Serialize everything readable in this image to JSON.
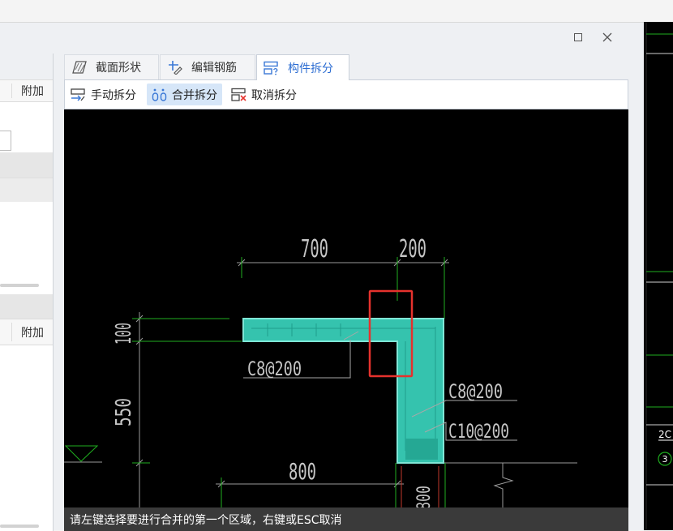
{
  "left_panel": {
    "header_top": "附加",
    "header_bottom": "附加"
  },
  "tabs": [
    {
      "label": "截面形状",
      "icon": "section-shape-icon",
      "active": false
    },
    {
      "label": "编辑钢筋",
      "icon": "edit-rebar-icon",
      "active": false
    },
    {
      "label": "构件拆分",
      "icon": "component-split-icon",
      "active": true
    }
  ],
  "toolbar": [
    {
      "label": "手动拆分",
      "icon": "manual-split-icon",
      "active": false
    },
    {
      "label": "合并拆分",
      "icon": "merge-split-icon",
      "active": true
    },
    {
      "label": "取消拆分",
      "icon": "cancel-split-icon",
      "active": false
    }
  ],
  "drawing": {
    "dim_top_left": "700",
    "dim_top_right": "200",
    "dim_left_top": "100",
    "dim_left_bottom": "550",
    "dim_bottom": "800",
    "dim_bottom_vertical": "800",
    "rebar_label_top": "C8@200",
    "rebar_label_right_1": "C8@200",
    "rebar_label_right_2": "C10@200"
  },
  "status_bar": {
    "message": "请左键选择要进行合并的第一个区域，右键或ESC取消"
  },
  "background_canvas": {
    "label": "2C",
    "marker": "3"
  },
  "window_controls": {
    "maximize": "maximize-icon",
    "close": "close-icon"
  },
  "colors": {
    "accent": "#2c6dd2",
    "active_button_bg": "#d6e6f8",
    "cad_background": "#000000",
    "cad_green": "#1fae1f",
    "member_fill": "#35c3ae",
    "highlight_red": "#e5322d",
    "status_bar_bg": "#3a3a3a"
  }
}
